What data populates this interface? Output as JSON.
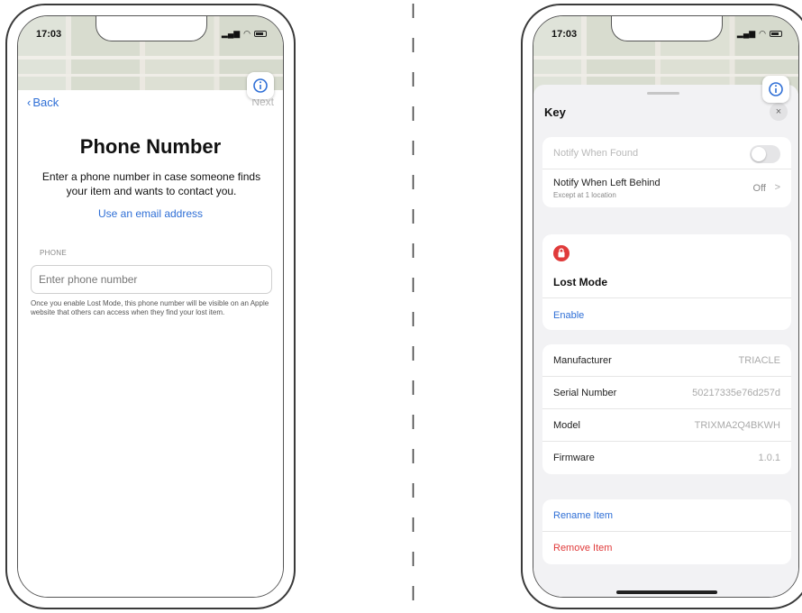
{
  "left": {
    "time": "17:03",
    "nav": {
      "back": "Back",
      "next": "Next"
    },
    "title": "Phone Number",
    "subtitle": "Enter a phone number in case someone finds your item and wants to contact you.",
    "email_link": "Use an email address",
    "field_label": "PHONE",
    "phone_placeholder": "Enter phone number",
    "note": "Once you enable Lost Mode, this phone number will be visible on an Apple website that others can access when they find your lost item."
  },
  "right": {
    "time": "17:03",
    "sheet_title": "Key",
    "close": "×",
    "notifications": {
      "found_label": "Notify When Found",
      "left_behind_label": "Notify When Left Behind",
      "left_behind_sub": "Except at 1 location",
      "left_behind_value": "Off",
      "chevron": ">"
    },
    "lost_mode": {
      "title": "Lost Mode",
      "enable": "Enable"
    },
    "info": [
      {
        "label": "Manufacturer",
        "value": "TRIACLE"
      },
      {
        "label": "Serial Number",
        "value": "50217335e76d257d"
      },
      {
        "label": "Model",
        "value": "TRIXMA2Q4BKWH"
      },
      {
        "label": "Firmware",
        "value": "1.0.1"
      }
    ],
    "actions": {
      "rename": "Rename Item",
      "remove": "Remove Item"
    }
  },
  "colors": {
    "accent": "#2f6fd6",
    "danger": "#e03a3a"
  }
}
